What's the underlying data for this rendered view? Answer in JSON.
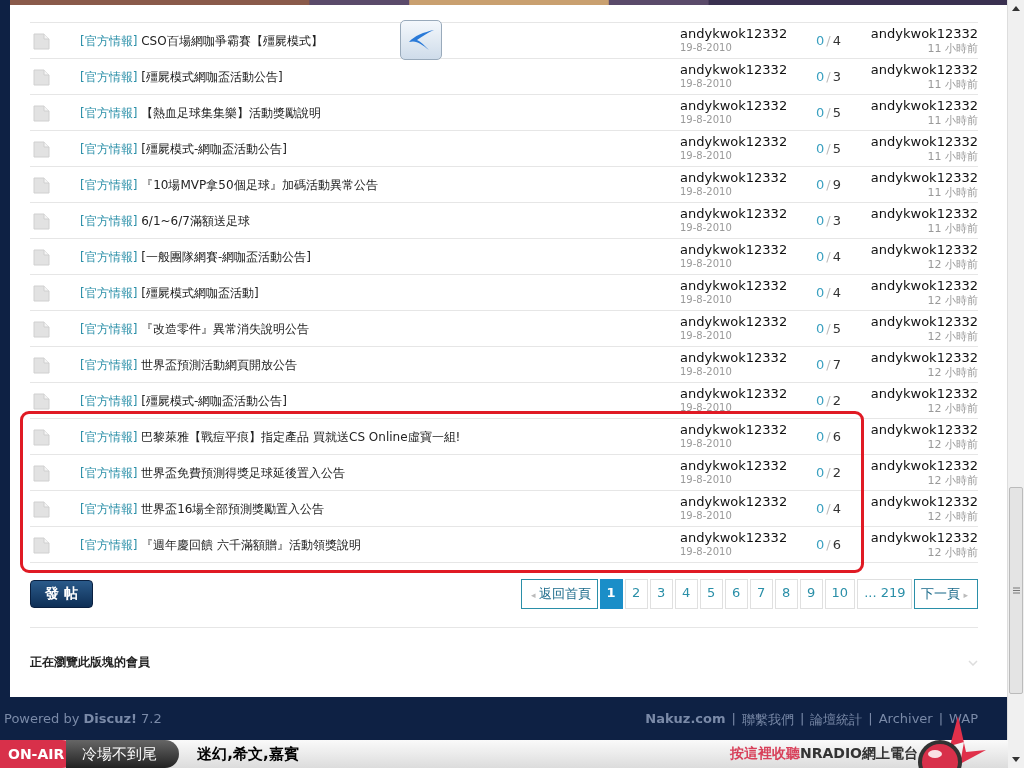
{
  "threads": [
    {
      "tag": "[官方情報]",
      "title": "CSO百場網咖爭霸賽【殭屍模式】",
      "author": "andykwok12332",
      "date": "19-8-2010",
      "replies": "0",
      "sep": "/",
      "views": "4",
      "last_author": "andykwok12332",
      "last_time": "11 小時前",
      "highlighted": false
    },
    {
      "tag": "[官方情報]",
      "title": "[殭屍模式網咖盃活動公告]",
      "author": "andykwok12332",
      "date": "19-8-2010",
      "replies": "0",
      "sep": "/",
      "views": "3",
      "last_author": "andykwok12332",
      "last_time": "11 小時前",
      "highlighted": false
    },
    {
      "tag": "[官方情報]",
      "title": "【熱血足球集集樂】活動獎勵說明",
      "author": "andykwok12332",
      "date": "19-8-2010",
      "replies": "0",
      "sep": "/",
      "views": "5",
      "last_author": "andykwok12332",
      "last_time": "11 小時前",
      "highlighted": false
    },
    {
      "tag": "[官方情報]",
      "title": "[殭屍模式-網咖盃活動公告]",
      "author": "andykwok12332",
      "date": "19-8-2010",
      "replies": "0",
      "sep": "/",
      "views": "5",
      "last_author": "andykwok12332",
      "last_time": "11 小時前",
      "highlighted": false
    },
    {
      "tag": "[官方情報]",
      "title": "『10場MVP拿50個足球』加碼活動異常公告",
      "author": "andykwok12332",
      "date": "19-8-2010",
      "replies": "0",
      "sep": "/",
      "views": "9",
      "last_author": "andykwok12332",
      "last_time": "11 小時前",
      "highlighted": false
    },
    {
      "tag": "[官方情報]",
      "title": "6/1~6/7滿額送足球",
      "author": "andykwok12332",
      "date": "19-8-2010",
      "replies": "0",
      "sep": "/",
      "views": "3",
      "last_author": "andykwok12332",
      "last_time": "11 小時前",
      "highlighted": false
    },
    {
      "tag": "[官方情報]",
      "title": "[一般團隊網賽-網咖盃活動公告]",
      "author": "andykwok12332",
      "date": "19-8-2010",
      "replies": "0",
      "sep": "/",
      "views": "4",
      "last_author": "andykwok12332",
      "last_time": "12 小時前",
      "highlighted": false
    },
    {
      "tag": "[官方情報]",
      "title": "[殭屍模式網咖盃活動]",
      "author": "andykwok12332",
      "date": "19-8-2010",
      "replies": "0",
      "sep": "/",
      "views": "4",
      "last_author": "andykwok12332",
      "last_time": "12 小時前",
      "highlighted": false
    },
    {
      "tag": "[官方情報]",
      "title": "『改造零件』異常消失說明公告",
      "author": "andykwok12332",
      "date": "19-8-2010",
      "replies": "0",
      "sep": "/",
      "views": "5",
      "last_author": "andykwok12332",
      "last_time": "12 小時前",
      "highlighted": false
    },
    {
      "tag": "[官方情報]",
      "title": "世界盃預測活動網頁開放公告",
      "author": "andykwok12332",
      "date": "19-8-2010",
      "replies": "0",
      "sep": "/",
      "views": "7",
      "last_author": "andykwok12332",
      "last_time": "12 小時前",
      "highlighted": false
    },
    {
      "tag": "[官方情報]",
      "title": "[殭屍模式-網咖盃活動公告]",
      "author": "andykwok12332",
      "date": "19-8-2010",
      "replies": "0",
      "sep": "/",
      "views": "2",
      "last_author": "andykwok12332",
      "last_time": "12 小時前",
      "highlighted": false
    },
    {
      "tag": "[官方情報]",
      "title": "巴黎萊雅【戰痘平痕】指定產品 買就送CS Online虛寶一組!",
      "author": "andykwok12332",
      "date": "19-8-2010",
      "replies": "0",
      "sep": "/",
      "views": "6",
      "last_author": "andykwok12332",
      "last_time": "12 小時前",
      "highlighted": true
    },
    {
      "tag": "[官方情報]",
      "title": "世界盃免費預測得獎足球延後置入公告",
      "author": "andykwok12332",
      "date": "19-8-2010",
      "replies": "0",
      "sep": "/",
      "views": "2",
      "last_author": "andykwok12332",
      "last_time": "12 小時前",
      "highlighted": true
    },
    {
      "tag": "[官方情報]",
      "title": "世界盃16場全部預測獎勵置入公告",
      "author": "andykwok12332",
      "date": "19-8-2010",
      "replies": "0",
      "sep": "/",
      "views": "4",
      "last_author": "andykwok12332",
      "last_time": "12 小時前",
      "highlighted": true
    },
    {
      "tag": "[官方情報]",
      "title": "『週年慶回饋 六千滿額贈』活動領獎說明",
      "author": "andykwok12332",
      "date": "19-8-2010",
      "replies": "0",
      "sep": "/",
      "views": "6",
      "last_author": "andykwok12332",
      "last_time": "12 小時前",
      "highlighted": true
    }
  ],
  "post_button": "發 帖",
  "pagination": {
    "back_caret": "◂",
    "back": "返回首頁",
    "next_caret": "▸",
    "pages": [
      {
        "label": "1",
        "selected": true
      },
      {
        "label": "2",
        "selected": false
      },
      {
        "label": "3",
        "selected": false
      },
      {
        "label": "4",
        "selected": false
      },
      {
        "label": "5",
        "selected": false
      },
      {
        "label": "6",
        "selected": false
      },
      {
        "label": "7",
        "selected": false
      },
      {
        "label": "8",
        "selected": false
      },
      {
        "label": "9",
        "selected": false
      },
      {
        "label": "10",
        "selected": false
      },
      {
        "label": "... 219",
        "selected": false
      }
    ],
    "next": "下一頁"
  },
  "members_heading": "正在瀏覽此版塊的會員",
  "footer": {
    "powered": "Powered by **Discuz!** 7.2",
    "links": [
      "Nakuz.com",
      "聯繫我們",
      "論壇統計",
      "Archiver",
      "WAP"
    ],
    "separators": [
      "|",
      "|",
      "|",
      "|"
    ]
  },
  "radio_bar": {
    "badge": "ON-AIR",
    "show": "冷場不到尾",
    "hosts": "迷幻,希文,嘉賓",
    "listen_prefix": "按這裡收聽",
    "listen_rest": "NRADIO網上電台"
  }
}
